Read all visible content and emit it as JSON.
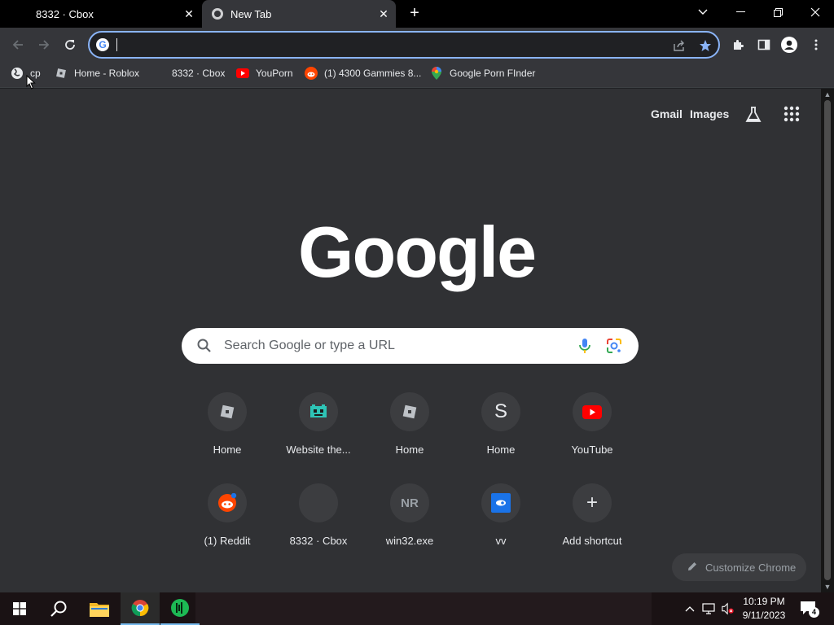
{
  "tabs": [
    {
      "title": "8332 · Cbox",
      "active": false
    },
    {
      "title": "New Tab",
      "active": true
    }
  ],
  "toolbar": {
    "omnibox_value": "",
    "omnibox_placeholder": ""
  },
  "bookmarks": [
    {
      "label": "cp",
      "icon": "globe-icon"
    },
    {
      "label": "Home - Roblox",
      "icon": "roblox-icon"
    },
    {
      "label": "8332 · Cbox",
      "icon": "none"
    },
    {
      "label": "YouPorn",
      "icon": "youtube-icon"
    },
    {
      "label": "(1) 4300 Gammies 8...",
      "icon": "reddit-icon"
    },
    {
      "label": "Google Porn FInder",
      "icon": "maps-pin-icon"
    }
  ],
  "ntp": {
    "gmail_label": "Gmail",
    "images_label": "Images",
    "logo_text": "Google",
    "search_placeholder": "Search Google or type a URL",
    "shortcuts_row1": [
      {
        "label": "Home",
        "icon": "roblox-icon"
      },
      {
        "label": "Website the...",
        "icon": "pixel-creature-icon"
      },
      {
        "label": "Home",
        "icon": "roblox-icon"
      },
      {
        "label": "Home",
        "icon": "letter-s-icon",
        "letter": "S"
      },
      {
        "label": "YouTube",
        "icon": "youtube-icon"
      }
    ],
    "shortcuts_row2": [
      {
        "label": "(1) Reddit",
        "icon": "reddit-icon"
      },
      {
        "label": "8332 · Cbox",
        "icon": "blank-icon"
      },
      {
        "label": "win32.exe",
        "icon": "letters-nr-icon",
        "letter": "NR"
      },
      {
        "label": "vv",
        "icon": "blue-app-icon"
      },
      {
        "label": "Add shortcut",
        "icon": "plus-icon",
        "letter": "+"
      }
    ],
    "customize_label": "Customize Chrome"
  },
  "taskbar": {
    "time": "10:19 PM",
    "date": "9/11/2023",
    "notification_count": "4"
  },
  "colors": {
    "accent": "#8ab4f8",
    "background": "#303134",
    "toolbar": "#35363a"
  }
}
